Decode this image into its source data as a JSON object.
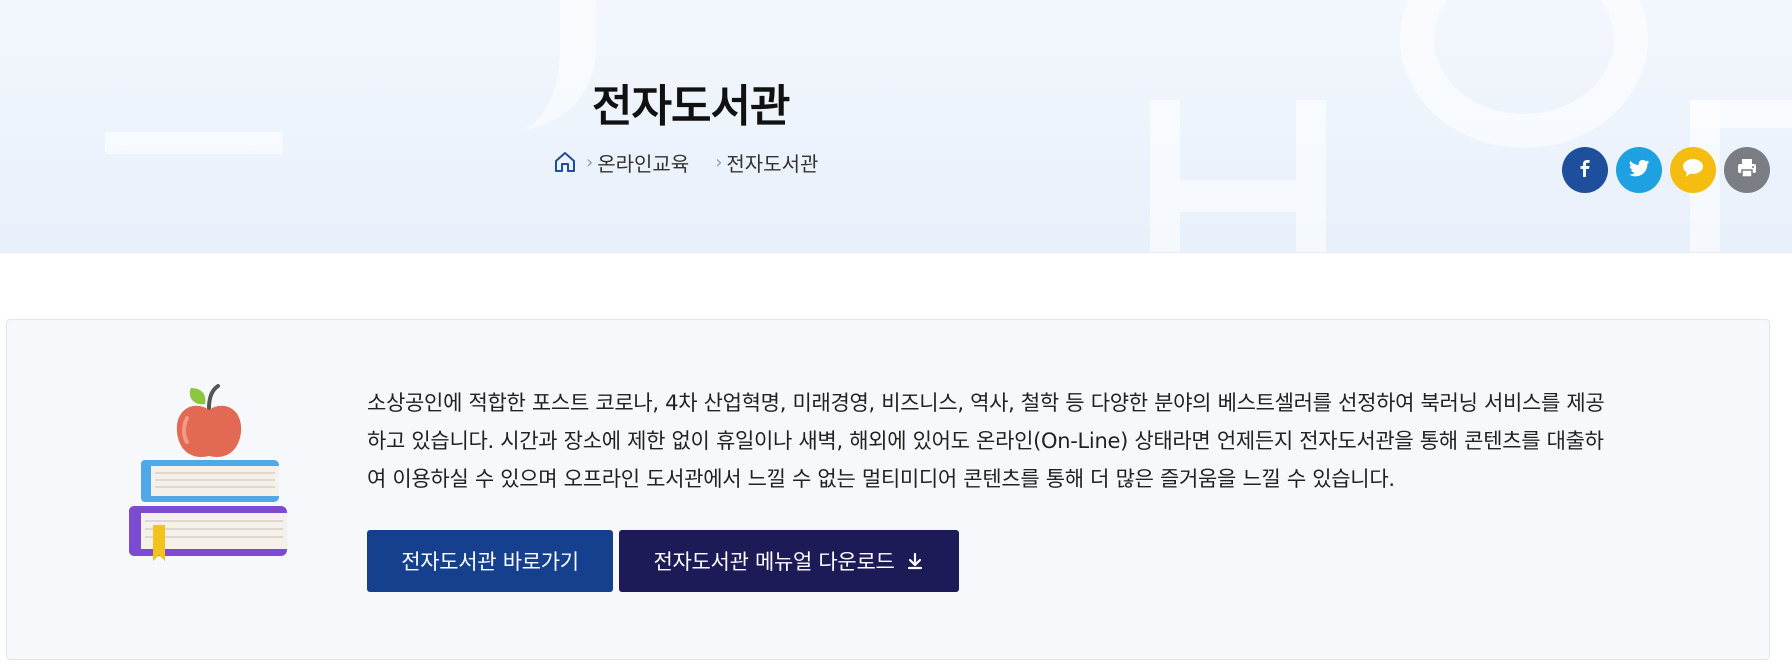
{
  "header": {
    "title": "전자도서관",
    "breadcrumb": {
      "home_icon": "home-icon",
      "items": [
        "온라인교육",
        "전자도서관"
      ]
    },
    "share": [
      {
        "name": "facebook",
        "icon": "facebook-icon",
        "color": "#1d4f9c"
      },
      {
        "name": "twitter",
        "icon": "twitter-icon",
        "color": "#1ea1e0"
      },
      {
        "name": "kakaostory",
        "icon": "speech-bubble-icon",
        "color": "#f5bd10"
      },
      {
        "name": "print",
        "icon": "printer-icon",
        "color": "#7a7d84"
      }
    ]
  },
  "main": {
    "illustration_icon": "books-apple-icon",
    "description": [
      "소상공인에 적합한 포스트 코로나, 4차 산업혁명, 미래경영, 비즈니스, 역사, 철학 등 다양한 분야의 베스트셀러를 선정하여 북러닝 서비스를 제공",
      "하고 있습니다. 시간과 장소에 제한 없이 휴일이나 새벽, 해외에 있어도 온라인(On-Line) 상태라면 언제든지 전자도서관을 통해 콘텐츠를 대출하",
      "여 이용하실 수 있으며 오프라인 도서관에서 느낄 수 없는 멀티미디어 콘텐츠를 통해 더 많은 즐거움을 느낄 수 있습니다."
    ],
    "buttons": {
      "go_label": "전자도서관 바로가기",
      "download_label": "전자도서관 메뉴얼 다운로드",
      "download_icon": "download-arrow-icon"
    }
  }
}
